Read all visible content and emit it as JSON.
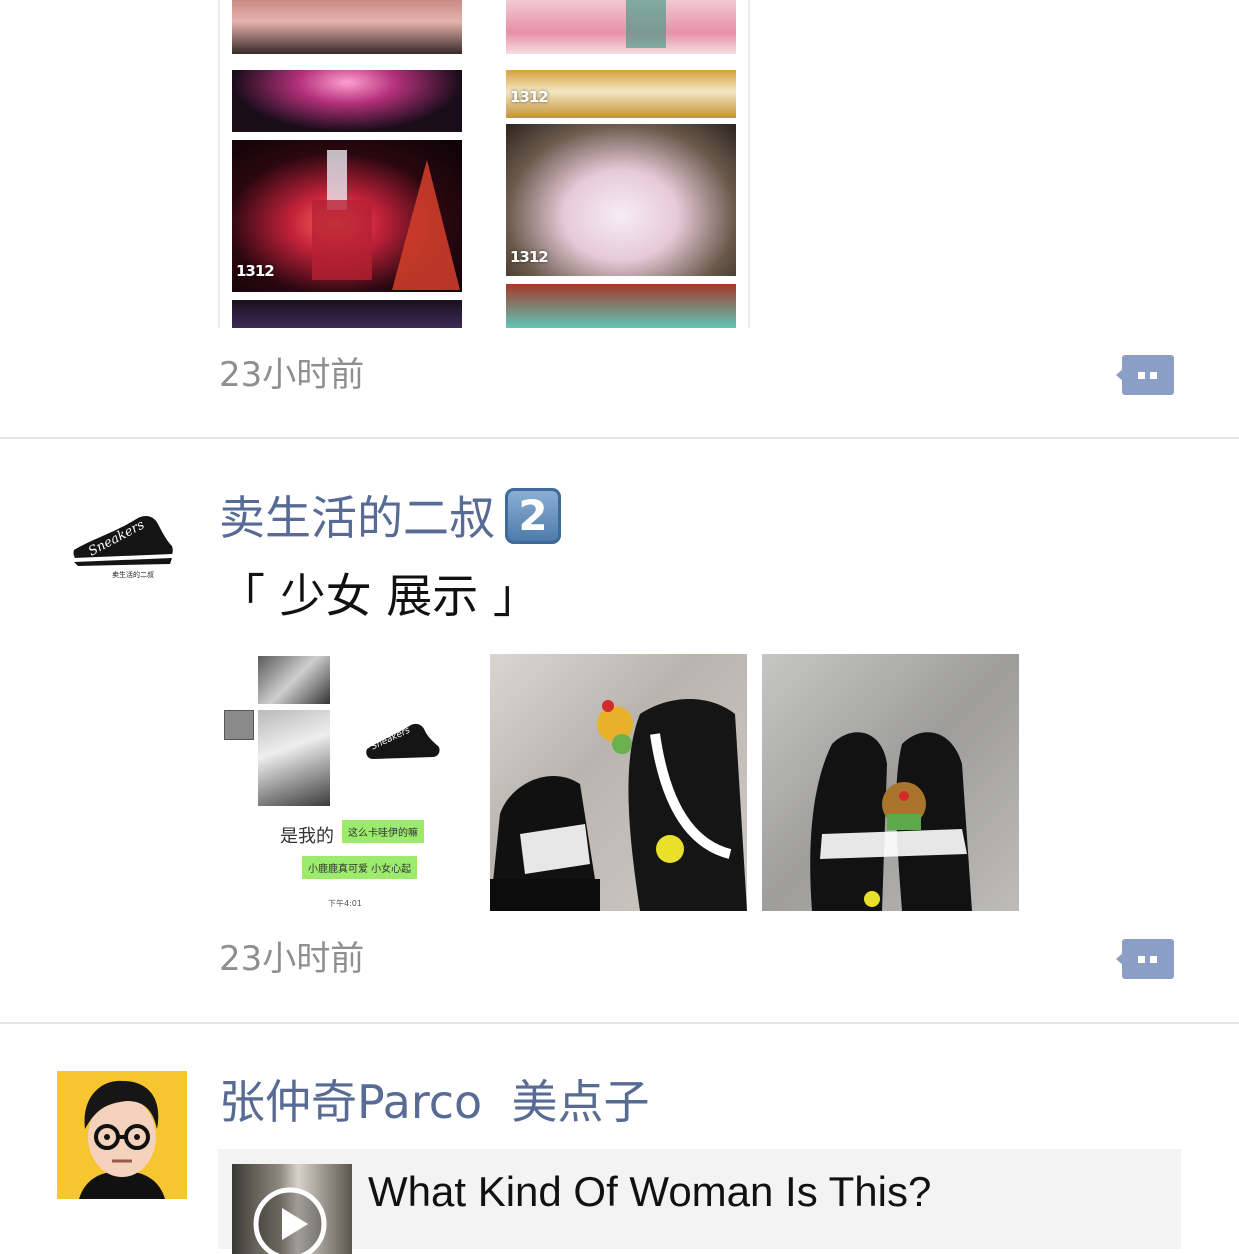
{
  "posts": [
    {
      "collage_brand_labels": [
        "1312",
        "1312",
        "1312"
      ],
      "timestamp": "23小时前",
      "comment_icon": "comment-dots-icon"
    },
    {
      "author": "卖生活的二叔",
      "badge": "2",
      "avatar_text": "Sneakers",
      "avatar_caption": "卖生活的二叔",
      "content": "「 少女 展示 」",
      "screenshot_image": {
        "sneakers_label": "Sneakers",
        "chat_bubble_1": "这么卡哇伊的嘛",
        "chat_bubble_2": "小鹿鹿真可爱 小女心起",
        "handwriting": "是我的",
        "time_label": "下午4:01"
      },
      "timestamp": "23小时前",
      "comment_icon": "comment-dots-icon"
    },
    {
      "author": "张仲奇Parco",
      "author_suffix": "美点子",
      "shared_title": "What Kind Of Woman Is This?",
      "share_icon": "play-icon"
    }
  ],
  "colors": {
    "name_blue": "#576b95",
    "timestamp_gray": "#8f8f8f",
    "comment_icon_bg": "#8b9fc6",
    "divider": "#e5e5e5"
  }
}
